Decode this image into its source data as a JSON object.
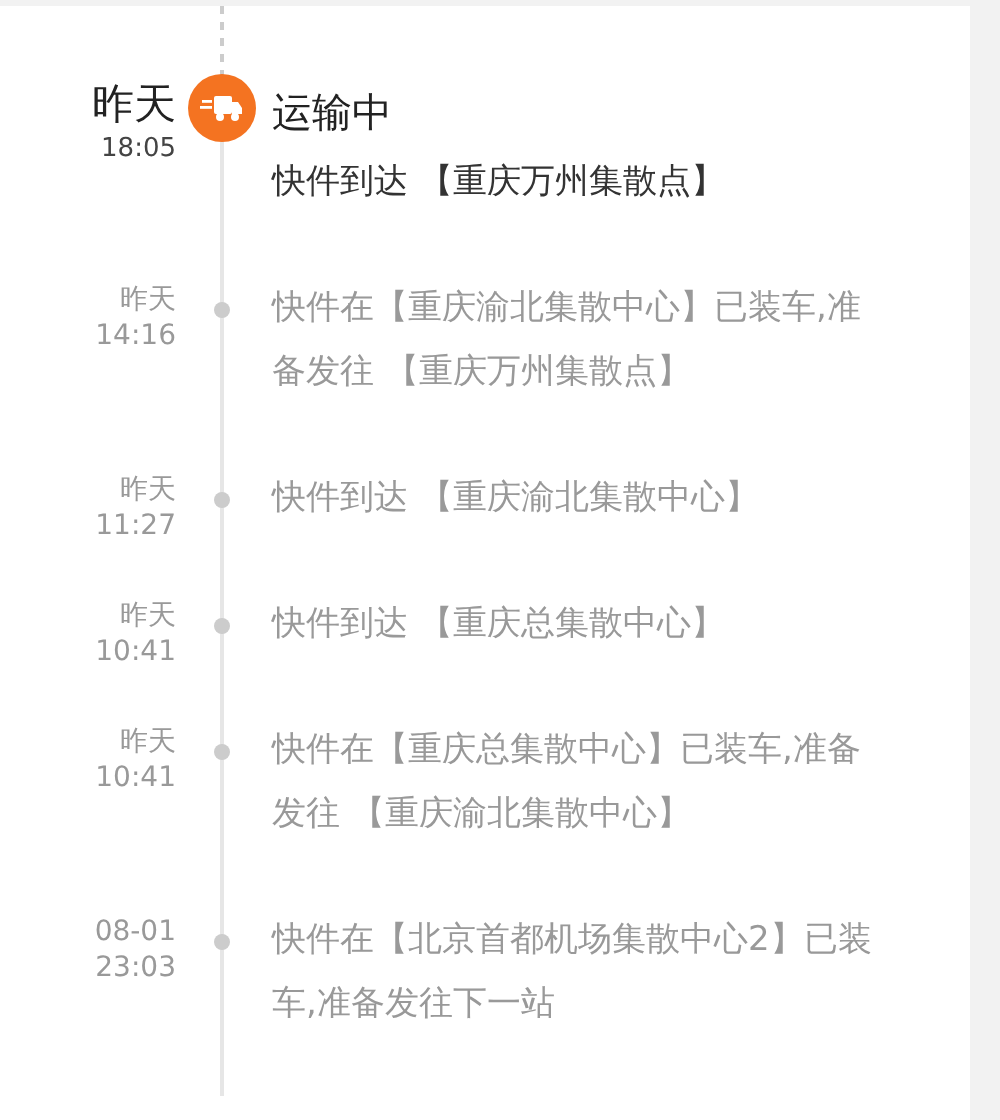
{
  "events": [
    {
      "current": true,
      "day": "昨天",
      "time": "18:05",
      "status": "运输中",
      "text": "快件到达 【重庆万州集散点】"
    },
    {
      "current": false,
      "day": "昨天",
      "time": "14:16",
      "text": "快件在【重庆渝北集散中心】已装车,准备发往 【重庆万州集散点】"
    },
    {
      "current": false,
      "day": "昨天",
      "time": "11:27",
      "text": "快件到达 【重庆渝北集散中心】"
    },
    {
      "current": false,
      "day": "昨天",
      "time": "10:41",
      "text": "快件到达 【重庆总集散中心】"
    },
    {
      "current": false,
      "day": "昨天",
      "time": "10:41",
      "text": "快件在【重庆总集散中心】已装车,准备发往 【重庆渝北集散中心】"
    },
    {
      "current": false,
      "day": "08-01",
      "time": "23:03",
      "text": "快件在【北京首都机场集散中心2】已装车,准备发往下一站"
    }
  ]
}
